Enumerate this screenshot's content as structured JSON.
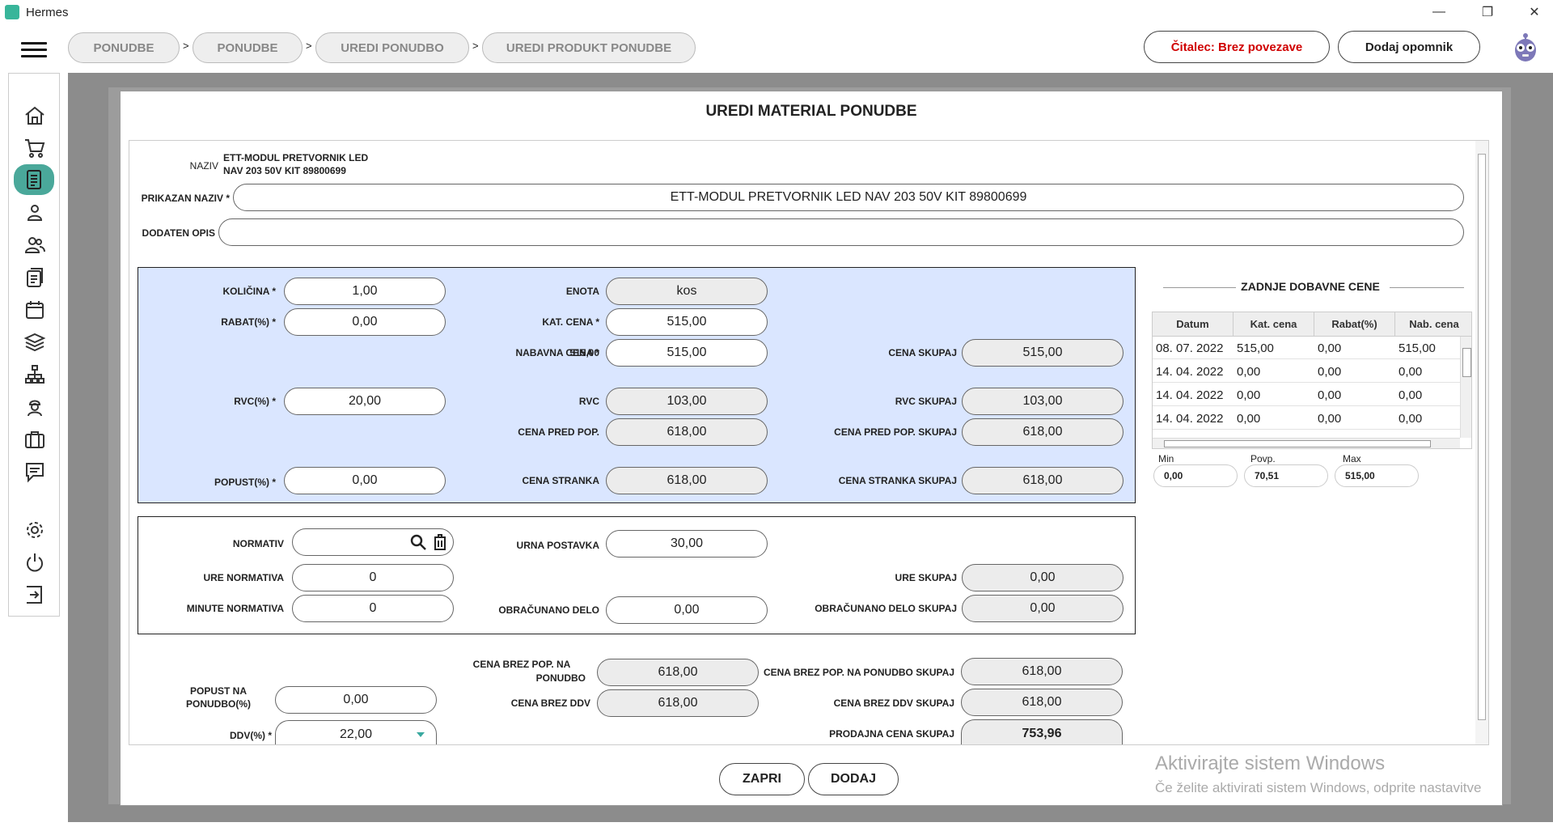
{
  "window": {
    "title": "Hermes",
    "minimize": "—",
    "maximize": "❐",
    "close": "✕"
  },
  "breadcrumbs": [
    "PONUDBE",
    "PONUDBE",
    "UREDI PONUDBO",
    "UREDI PRODUKT PONUDBE"
  ],
  "breadcrumb_sep": ">",
  "header": {
    "reader_status": "Čitalec: Brez povezave",
    "reminder_button": "Dodaj opomnik"
  },
  "sidebar_icons": [
    "home-icon",
    "cart-icon",
    "document-icon",
    "user-icon",
    "users-icon",
    "list-icon",
    "calendar-icon",
    "layers-icon",
    "hierarchy-icon",
    "worker-icon",
    "briefcase-icon",
    "chat-icon",
    "gear-icon",
    "power-icon",
    "logout-icon"
  ],
  "modal": {
    "title": "UREDI MATERIAL PONUDBE",
    "naziv_label": "NAZIV",
    "naziv_line1": "ETT-MODUL PRETVORNIK LED",
    "naziv_line2": "NAV 203 50V KIT 89800699",
    "prikazan_label": "PRIKAZAN NAZIV *",
    "prikazan_value": "ETT-MODUL PRETVORNIK LED NAV 203 50V KIT 89800699",
    "opis_label": "DODATEN OPIS",
    "opis_value": "",
    "kolicina_label": "KOLIČINA *",
    "kolicina_value": "1,00",
    "rabat_label": "RABAT(%) *",
    "rabat_value": "0,00",
    "rvc_label": "RVC(%) *",
    "rvc_value": "20,00",
    "popust_label": "POPUST(%) *",
    "popust_value": "0,00",
    "enota_label": "ENOTA",
    "enota_value": "kos",
    "katcena_label": "KAT. CENA *",
    "katcena_value": "515,00",
    "nabavna_label": "NABAVNA CENA *",
    "nabavna_value": "515,00",
    "rvcamt_label": "RVC",
    "rvcamt_value": "103,00",
    "predpop_label": "CENA PRED POP.",
    "predpop_value": "618,00",
    "stranka_label": "CENA STRANKA",
    "stranka_value": "618,00",
    "skupaj_label": "CENA SKUPAJ",
    "skupaj_value": "515,00",
    "rvcskupaj_label": "RVC SKUPAJ",
    "rvcskupaj_value": "103,00",
    "predpopskupaj_label": "CENA PRED POP. SKUPAJ",
    "predpopskupaj_value": "618,00",
    "strankaskupaj_label": "CENA STRANKA SKUPAJ",
    "strankaskupaj_value": "618,00",
    "normativ_label": "NORMATIV",
    "normativ_value": "",
    "urenorm_label": "URE NORMATIVA",
    "urenorm_value": "0",
    "minnorm_label": "MINUTE NORMATIVA",
    "minnorm_value": "0",
    "urna_label": "URNA POSTAVKA",
    "urna_value": "30,00",
    "obracunano_label": "OBRAČUNANO DELO",
    "obracunano_value": "0,00",
    "ureskupaj_label": "URE SKUPAJ",
    "ureskupaj_value": "0,00",
    "obracunanoskupaj_label": "OBRAČUNANO DELO SKUPAJ",
    "obracunanoskupaj_value": "0,00",
    "popustponudbo_label1": "POPUST NA",
    "popustponudbo_label2": "PONUDBO(%)",
    "popustponudbo_value": "0,00",
    "ddv_label": "DDV(%) *",
    "ddv_value": "22,00",
    "brezpop_label1": "CENA BREZ POP. NA",
    "brezpop_label2": "PONUDBO",
    "brezpop_value": "618,00",
    "brezddv_label": "CENA BREZ DDV",
    "brezddv_value": "618,00",
    "brezpopskupaj_label": "CENA BREZ POP. NA PONUDBO SKUPAJ",
    "brezpopskupaj_value": "618,00",
    "brezddvskupaj_label": "CENA BREZ DDV SKUPAJ",
    "brezddvskupaj_value": "618,00",
    "prodajna_label": "PRODAJNA CENA SKUPAJ",
    "prodajna_value": "753,96",
    "history": {
      "title": "ZADNJE DOBAVNE CENE",
      "columns": [
        "Datum",
        "Kat. cena",
        "Rabat(%)",
        "Nab. cena"
      ],
      "rows": [
        [
          "08. 07. 2022",
          "515,00",
          "0,00",
          "515,00"
        ],
        [
          "14. 04. 2022",
          "0,00",
          "0,00",
          "0,00"
        ],
        [
          "14. 04. 2022",
          "0,00",
          "0,00",
          "0,00"
        ],
        [
          "14. 04. 2022",
          "0,00",
          "0,00",
          "0,00"
        ]
      ],
      "min_label": "Min",
      "min_value": "0,00",
      "avg_label": "Povp.",
      "avg_value": "70,51",
      "max_label": "Max",
      "max_value": "515,00"
    },
    "close_button": "ZAPRI",
    "add_button": "DODAJ"
  },
  "watermark": {
    "line1": "Aktivirajte sistem Windows",
    "line2": "Če želite aktivirati sistem Windows, odprite nastavitve"
  }
}
